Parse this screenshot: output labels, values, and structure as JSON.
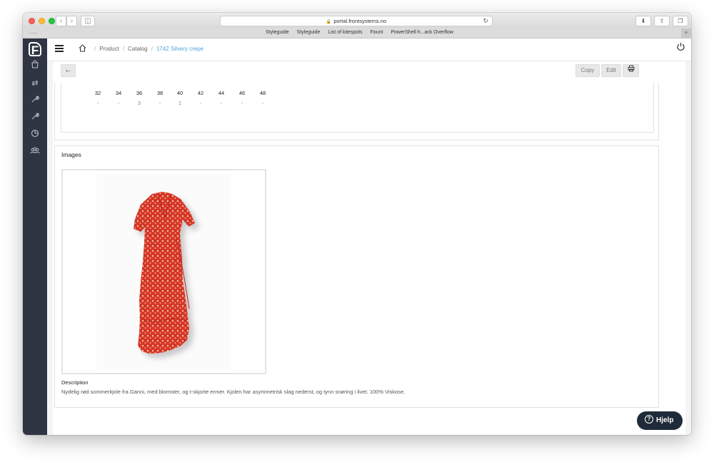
{
  "browser": {
    "url": "portal.frontsystems.no",
    "bookmarks": [
      "Styleguide",
      "Styleguide",
      "List of kitespots",
      "Fount",
      "PowerShell h...ack Overflow"
    ]
  },
  "breadcrumb": {
    "home_icon": "home-icon",
    "items": [
      "Product",
      "Catalog",
      "1742 Silvery crepe"
    ]
  },
  "toolbar": {
    "copy_label": "Copy",
    "edit_label": "Edit",
    "print_icon": "print-icon"
  },
  "sizes": [
    {
      "size": "32",
      "qty": "-"
    },
    {
      "size": "34",
      "qty": "-"
    },
    {
      "size": "36",
      "qty": "3"
    },
    {
      "size": "38",
      "qty": "-"
    },
    {
      "size": "40",
      "qty": "1"
    },
    {
      "size": "42",
      "qty": "-"
    },
    {
      "size": "44",
      "qty": "-"
    },
    {
      "size": "46",
      "qty": "-"
    },
    {
      "size": "48",
      "qty": "-"
    }
  ],
  "images_section": {
    "title": "Images",
    "image_subject": "red floral wrap dress"
  },
  "description": {
    "label": "Description",
    "text": "Nydelig rød sommerkjole fra Ganni, med blomster, og t-skjorte ermer. Kjolen har asymmetrisk slag nederst, og tynn snøring i livet. 100% Viskose."
  },
  "help": {
    "label": "Hjelp"
  },
  "colors": {
    "sidebar": "#2f3542",
    "link": "#4ea6d8",
    "help_button": "#1f2b3a",
    "dress_red": "#d8372c"
  }
}
